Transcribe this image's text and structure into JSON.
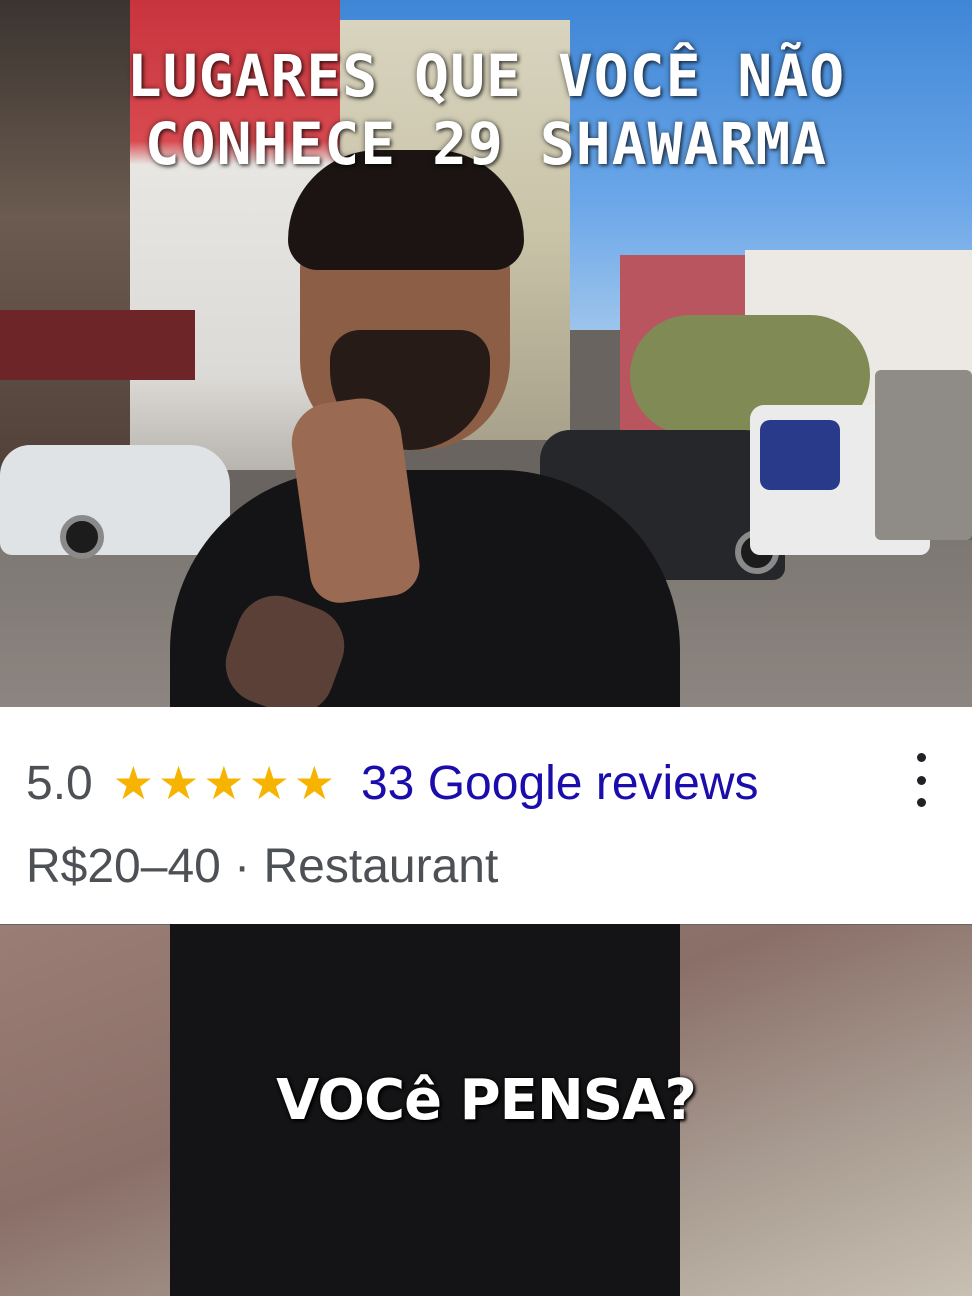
{
  "overlay_title": {
    "line1": "LUGARES QUE VOCÊ NÃO",
    "line2": "CONHECE 29 SHAWARMA"
  },
  "place_card": {
    "rating": "5.0",
    "stars": [
      "★",
      "★",
      "★",
      "★",
      "★"
    ],
    "star_rating_value": 5,
    "star_rating_max": 5,
    "reviews_link": "33 Google reviews",
    "price_and_category": "R$20–40 · Restaurant",
    "more_options_icon": "kebab-vertical-icon"
  },
  "caption": "VOCê PENSA?",
  "colors": {
    "star": "#f6b400",
    "link": "#1a0dab",
    "meta_text": "#4d5156"
  }
}
